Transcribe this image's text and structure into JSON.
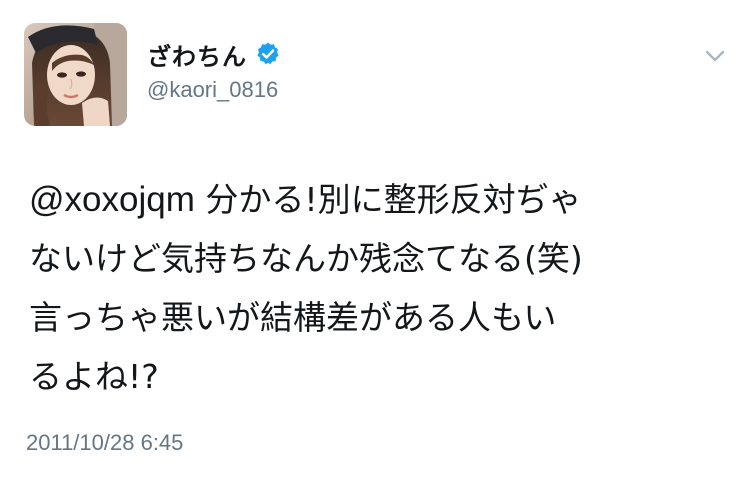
{
  "user": {
    "display_name": "ざわちん",
    "handle": "@kaori_0816",
    "verified": true,
    "verified_color": "#1da1f2"
  },
  "tweet": {
    "mention": "@xoxojqm",
    "lines": [
      " 分かる!別に整形反対ぢゃ",
      "ないけど気持ちなんか残念てなる(笑)",
      "言っちゃ悪いが結構差がある人もい",
      "るよね!?"
    ],
    "timestamp": "2011/10/28 6:45"
  },
  "icons": {
    "menu": "chevron-down-icon",
    "badge": "verified-badge-icon"
  },
  "colors": {
    "text": "#14171a",
    "secondary": "#657786",
    "chevron": "#aab8c2"
  }
}
